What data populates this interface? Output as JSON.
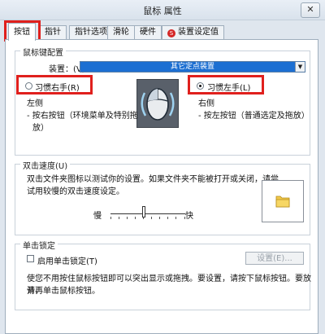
{
  "window": {
    "title": "鼠标 属性",
    "close_label": "✕"
  },
  "tabs": [
    {
      "label": "按钮"
    },
    {
      "label": "指针"
    },
    {
      "label": "指针选项"
    },
    {
      "label": "滑轮"
    },
    {
      "label": "硬件"
    },
    {
      "label": "装置设定值",
      "icon_text": "S"
    }
  ],
  "button_config": {
    "group_label": "鼠标键配置",
    "device_label": "装置：(V)",
    "device_value": "其它定点装置",
    "right_hand_label": "习惯右手(R)",
    "left_hand_label": "习惯左手(L)",
    "selected": "left_hand",
    "left_side_title": "左侧",
    "left_side_desc_1": "- 按右按钮（环境菜单及特别拖",
    "left_side_desc_2": "放）",
    "right_side_title": "右侧",
    "right_side_desc_1": "- 按左按钮（普通选定及拖放）"
  },
  "double_click": {
    "group_label": "双击速度(U)",
    "desc_1": "双击文件夹图标以测试你的设置。如果文件夹不能被打开或关闭，请尝",
    "desc_2": "试用较慢的双击速度设定。",
    "slow_label": "慢",
    "fast_label": "快",
    "speed_level": 0.45
  },
  "click_lock": {
    "group_label": "单击锁定",
    "checkbox_label": "启用单击锁定(T)",
    "checked": false,
    "settings_label": "设置(E)...",
    "desc_1": "使您不用按住鼠标按钮即可以突出显示或拖拽。要设置，请按下鼠标按钮。要放开，",
    "desc_2": "请再单击鼠标按钮。"
  },
  "colors": {
    "highlight": "#e0201d",
    "accent": "#1c6fd2"
  }
}
